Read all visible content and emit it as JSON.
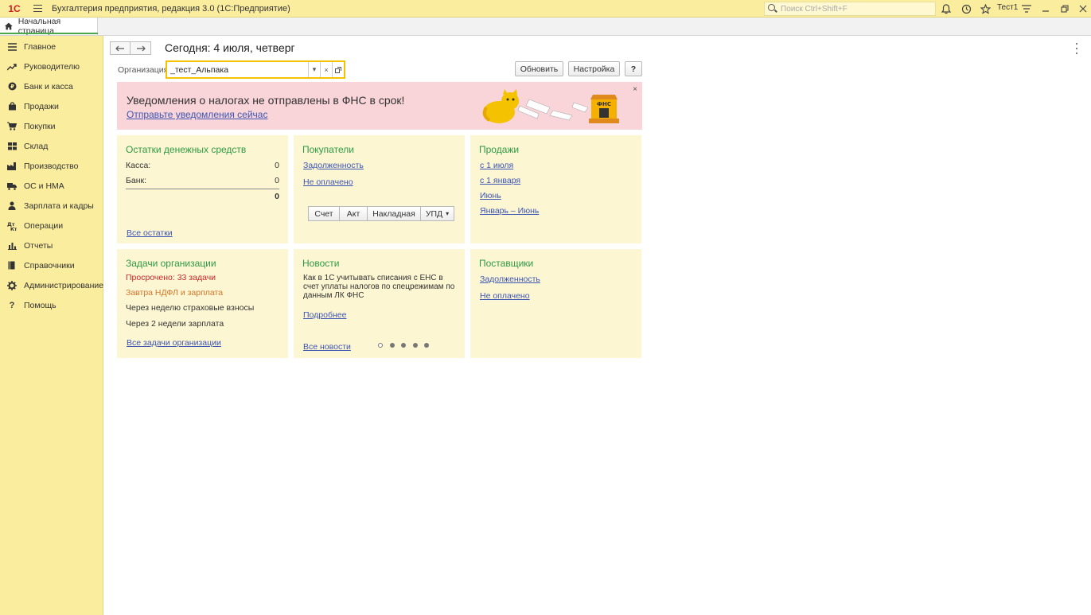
{
  "window": {
    "logo": "1С",
    "title": "Бухгалтерия предприятия, редакция 3.0  (1С:Предприятие)",
    "search_placeholder": "Поиск Ctrl+Shift+F",
    "user": "Тест1"
  },
  "tabs": [
    {
      "label": "Начальная страница"
    }
  ],
  "sidebar": {
    "items": [
      {
        "label": "Главное",
        "icon": "menu-icon"
      },
      {
        "label": "Руководителю",
        "icon": "trend-icon"
      },
      {
        "label": "Банк и касса",
        "icon": "bank-icon"
      },
      {
        "label": "Продажи",
        "icon": "bag-icon"
      },
      {
        "label": "Покупки",
        "icon": "cart-icon"
      },
      {
        "label": "Склад",
        "icon": "warehouse-icon"
      },
      {
        "label": "Производство",
        "icon": "factory-icon"
      },
      {
        "label": "ОС и НМА",
        "icon": "truck-icon"
      },
      {
        "label": "Зарплата и кадры",
        "icon": "person-icon"
      },
      {
        "label": "Операции",
        "icon": "operations-icon"
      },
      {
        "label": "Отчеты",
        "icon": "chart-icon"
      },
      {
        "label": "Справочники",
        "icon": "book-icon"
      },
      {
        "label": "Администрирование",
        "icon": "gear-icon"
      },
      {
        "label": "Помощь",
        "icon": "help-icon"
      }
    ]
  },
  "main": {
    "title": "Сегодня: 4 июля, четверг",
    "org_label": "Организация:",
    "org_value": "_тест_Альпака",
    "buttons": {
      "refresh": "Обновить",
      "settings": "Настройка",
      "help": "?"
    }
  },
  "notice": {
    "title": "Уведомления о налогах не отправлены в ФНС в срок!",
    "link": "Отправьте уведомления сейчас",
    "close": "×",
    "emblem_text": "ФНС"
  },
  "cash": {
    "title": "Остатки денежных средств",
    "rows": [
      {
        "label": "Касса:",
        "value": "0"
      },
      {
        "label": "Банк:",
        "value": "0"
      }
    ],
    "total": "0",
    "link": "Все остатки"
  },
  "buyers": {
    "title": "Покупатели",
    "links": [
      "Задолженность",
      "Не оплачено"
    ],
    "actions": [
      "Счет",
      "Акт",
      "Накладная",
      "УПД"
    ]
  },
  "sales": {
    "title": "Продажи",
    "links": [
      "с 1 июля",
      "с 1 января",
      "Июнь",
      "Январь – Июнь"
    ]
  },
  "tasks": {
    "title": "Задачи организации",
    "items": [
      {
        "text": "Просрочено: 33 задачи",
        "status": "overdue"
      },
      {
        "text": "Завтра НДФЛ и зарплата",
        "status": "tomorrow"
      },
      {
        "text": "Через неделю страховые взносы",
        "status": "normal"
      },
      {
        "text": "Через 2 недели зарплата",
        "status": "normal"
      }
    ],
    "link": "Все задачи организации"
  },
  "news": {
    "title": "Новости",
    "text": "Как в 1С учитывать списания с ЕНС в счет уплаты налогов по спецрежимам по данным ЛК ФНС",
    "more": "Подробнее",
    "all": "Все новости",
    "pages": 5,
    "active_page": 1
  },
  "suppliers": {
    "title": "Поставщики",
    "links": [
      "Задолженность",
      "Не оплачено"
    ]
  },
  "colors": {
    "accent_yellow": "#fbed9e",
    "card_bg": "#fdf6d2",
    "title_green": "#2c9a43",
    "link_blue": "#3d55b4",
    "alert_red": "#c8282b",
    "warn_orange": "#d7752a",
    "notice_pink": "#f9d5d9"
  }
}
